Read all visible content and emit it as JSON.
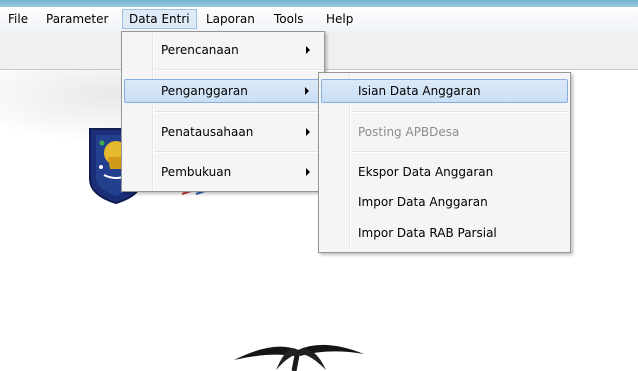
{
  "menubar": {
    "items": [
      {
        "label": "File"
      },
      {
        "label": "Parameter"
      },
      {
        "label": "Data Entri"
      },
      {
        "label": "Laporan"
      },
      {
        "label": "Tools"
      },
      {
        "label": "Help"
      }
    ]
  },
  "data_entri_menu": {
    "items": [
      {
        "label": "Perencanaan",
        "has_submenu": true
      },
      {
        "label": "Penganggaran",
        "has_submenu": true,
        "highlighted": true
      },
      {
        "label": "Penatausahaan",
        "has_submenu": true
      },
      {
        "label": "Pembukuan",
        "has_submenu": true
      }
    ]
  },
  "penganggaran_submenu": {
    "items": [
      {
        "label": "Isian Data Anggaran",
        "highlighted": true
      },
      {
        "label": "Posting APBDesa",
        "disabled": true
      },
      {
        "label": "Ekspor Data Anggaran"
      },
      {
        "label": "Impor Data Anggaran"
      },
      {
        "label": "Impor Data RAB Parsial"
      }
    ]
  },
  "icons": [
    "garuda-emblem-icon",
    "submenu-arrow-icon",
    "palm-tree-icon"
  ],
  "colors": {
    "highlight": "#c9def5",
    "highlight_border": "#88aee0",
    "menu_bg": "#f5f5f5",
    "disabled_text": "#8d8d8d",
    "titlebar": "#6fb3cf"
  }
}
